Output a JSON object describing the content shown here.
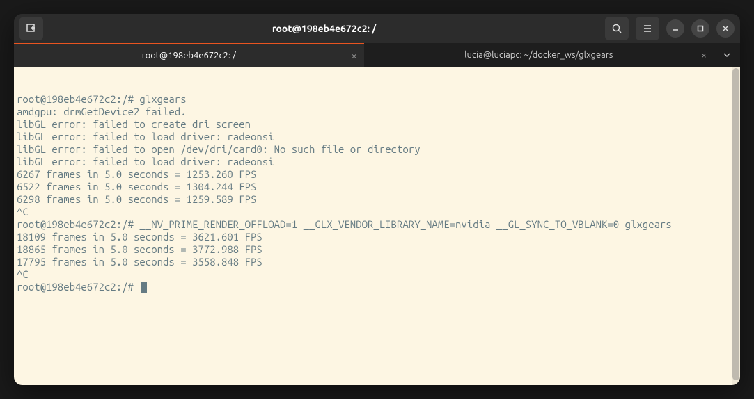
{
  "window": {
    "title": "root@198eb4e672c2: /"
  },
  "tabs": [
    {
      "label": "root@198eb4e672c2: /",
      "active": true
    },
    {
      "label": "lucia@luciapc: ~/docker_ws/glxgears",
      "active": false
    }
  ],
  "terminal": {
    "lines": [
      {
        "prompt": "root@198eb4e672c2:/# ",
        "cmd": "glxgears"
      },
      {
        "out": "amdgpu: drmGetDevice2 failed."
      },
      {
        "out": "libGL error: failed to create dri screen"
      },
      {
        "out": "libGL error: failed to load driver: radeonsi"
      },
      {
        "out": "libGL error: failed to open /dev/dri/card0: No such file or directory"
      },
      {
        "out": "libGL error: failed to load driver: radeonsi"
      },
      {
        "out": "6267 frames in 5.0 seconds = 1253.260 FPS"
      },
      {
        "out": "6522 frames in 5.0 seconds = 1304.244 FPS"
      },
      {
        "out": "6298 frames in 5.0 seconds = 1259.589 FPS"
      },
      {
        "out": "^C"
      },
      {
        "prompt": "root@198eb4e672c2:/# ",
        "cmd": "__NV_PRIME_RENDER_OFFLOAD=1 __GLX_VENDOR_LIBRARY_NAME=nvidia __GL_SYNC_TO_VBLANK=0 glxgears"
      },
      {
        "out": "18109 frames in 5.0 seconds = 3621.601 FPS"
      },
      {
        "out": "18865 frames in 5.0 seconds = 3772.988 FPS"
      },
      {
        "out": "17795 frames in 5.0 seconds = 3558.848 FPS"
      },
      {
        "out": "^C"
      },
      {
        "prompt": "root@198eb4e672c2:/# ",
        "cmd": "",
        "cursor": true
      }
    ]
  }
}
